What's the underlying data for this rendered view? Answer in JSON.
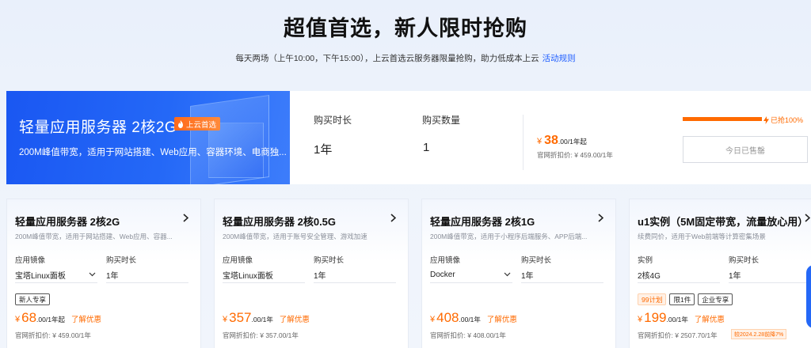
{
  "hero": {
    "title": "超值首选，新人限时抢购",
    "subtitle": "每天两场（上午10:00，下午15:00），上云首选云服务器限量抢购，助力低成本上云",
    "rules_link": "活动规则"
  },
  "featured": {
    "title": "轻量应用服务器 2核2G",
    "badge": "上云首选",
    "description": "200M峰值带宽，适用于网站搭建、Web应用、容器环境、电商独...",
    "duration_label": "购买时长",
    "duration_value": "1年",
    "quantity_label": "购买数量",
    "quantity_value": "1",
    "price_symbol": "¥",
    "price": "38",
    "price_unit": ".00/1年起",
    "original_price": "官网折扣价: ¥ 459.00/1年",
    "progress_percent": 100,
    "progress_text": "已抢100%",
    "sold_out_label": "今日已售罄"
  },
  "cards": [
    {
      "title": "轻量应用服务器 2核2G",
      "description": "200M峰值带宽，适用于网站搭建、Web应用、容器...",
      "field1_label": "应用镜像",
      "field1_value": "宝塔Linux面板",
      "field2_label": "购买时长",
      "field2_value": "1年",
      "tags": [
        "新人专享"
      ],
      "price_symbol": "¥",
      "price": "68",
      "price_unit": ".00/1年起",
      "link": "了解优惠",
      "original_price": "官网折扣价: ¥ 459.00/1年"
    },
    {
      "title": "轻量应用服务器 2核0.5G",
      "description": "200M峰值带宽，适用于账号安全管理、游戏加速",
      "field1_label": "应用镜像",
      "field1_value": "宝塔Linux面板",
      "field2_label": "购买时长",
      "field2_value": "1年",
      "tags": [],
      "price_symbol": "¥",
      "price": "357",
      "price_unit": ".00/1年",
      "link": "了解优惠",
      "original_price": "官网折扣价: ¥ 357.00/1年"
    },
    {
      "title": "轻量应用服务器 2核1G",
      "description": "200M峰值带宽，适用于小程序后端服务、APP后端...",
      "field1_label": "应用镜像",
      "field1_value": "Docker",
      "field2_label": "购买时长",
      "field2_value": "1年",
      "tags": [],
      "price_symbol": "¥",
      "price": "408",
      "price_unit": ".00/1年",
      "link": "了解优惠",
      "original_price": "官网折扣价: ¥ 408.00/1年"
    },
    {
      "title": "u1实例（5M固定带宽，流量放心用）",
      "description": "续费同价，适用于Web前端等计算密集场景",
      "field1_label": "实例",
      "field1_value": "2核4G",
      "field2_label": "购买时长",
      "field2_value": "1年",
      "tags": [
        "99计划",
        "限1件",
        "企业专享"
      ],
      "price_symbol": "¥",
      "price": "199",
      "price_unit": ".00/1年",
      "link": "了解优惠",
      "original_price": "官网折扣价: ¥ 2507.70/1年",
      "promo": "较2024.2.28前降7%"
    }
  ],
  "colors": {
    "accent": "#ff6a00",
    "brand_blue": "#2468f7"
  }
}
